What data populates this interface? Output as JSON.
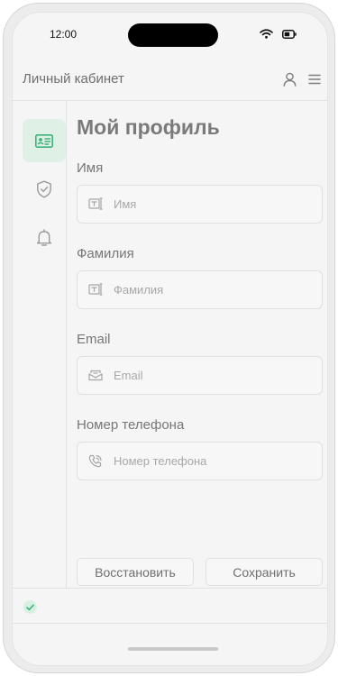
{
  "status_bar": {
    "time": "12:00",
    "icons": [
      "wifi-icon",
      "battery-icon"
    ]
  },
  "header": {
    "title": "Личный кабинет",
    "icons": [
      "user-icon",
      "menu-icon"
    ]
  },
  "sidebar": {
    "items": [
      {
        "icon": "id-card-icon",
        "active": true
      },
      {
        "icon": "shield-check-icon",
        "active": false
      },
      {
        "icon": "bell-icon",
        "active": false
      }
    ]
  },
  "main": {
    "title": "Мой профиль",
    "fields": [
      {
        "label": "Имя",
        "placeholder": "Имя",
        "value": "",
        "icon": "text-field-icon"
      },
      {
        "label": "Фамилия",
        "placeholder": "Фамилия",
        "value": "",
        "icon": "text-field-icon"
      },
      {
        "label": "Email",
        "placeholder": "Email",
        "value": "",
        "icon": "mail-icon"
      },
      {
        "label": "Номер телефона",
        "placeholder": "Номер телефона",
        "value": "",
        "icon": "phone-icon"
      }
    ],
    "buttons": {
      "restore": "Восстановить",
      "save": "Сохранить"
    }
  },
  "footer": {
    "status_icon": "check-icon"
  },
  "colors": {
    "accent": "#3bb37a",
    "accent_bg": "#dff1e7",
    "background": "#f5f5f5",
    "border": "#e0e0e0"
  }
}
